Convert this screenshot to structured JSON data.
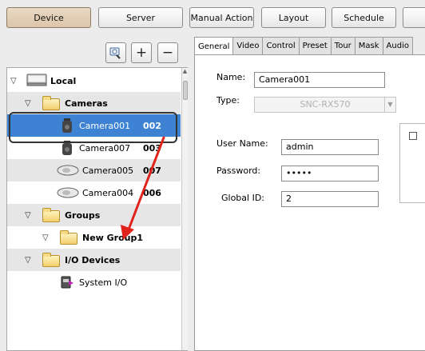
{
  "toolbar": {
    "device": "Device",
    "server": "Server",
    "manual_action": "Manual Action",
    "layout": "Layout",
    "schedule": "Schedule"
  },
  "tree_tools": {
    "add": "+",
    "remove": "−"
  },
  "tree": {
    "local": "Local",
    "cameras": "Cameras",
    "camera_items": [
      {
        "name": "Camera001",
        "id": "002"
      },
      {
        "name": "Camera007",
        "id": "003"
      },
      {
        "name": "Camera005",
        "id": "007"
      },
      {
        "name": "Camera004",
        "id": "006"
      }
    ],
    "groups": "Groups",
    "new_group": "New Group1",
    "io_devices": "I/O Devices",
    "system_io": "System I/O"
  },
  "tabs": [
    "General",
    "Video",
    "Control",
    "Preset",
    "Tour",
    "Mask",
    "Audio"
  ],
  "form": {
    "name_label": "Name:",
    "name_value": "Camera001",
    "type_label": "Type:",
    "type_value": "SNC-RX570",
    "username_label": "User Name:",
    "username_value": "admin",
    "password_label": "Password:",
    "password_value": "•••••",
    "globalid_label": "Global ID:",
    "globalid_value": "2"
  },
  "colors": {
    "selection": "#3d82d3",
    "annotation_arrow": "#e0241c"
  }
}
